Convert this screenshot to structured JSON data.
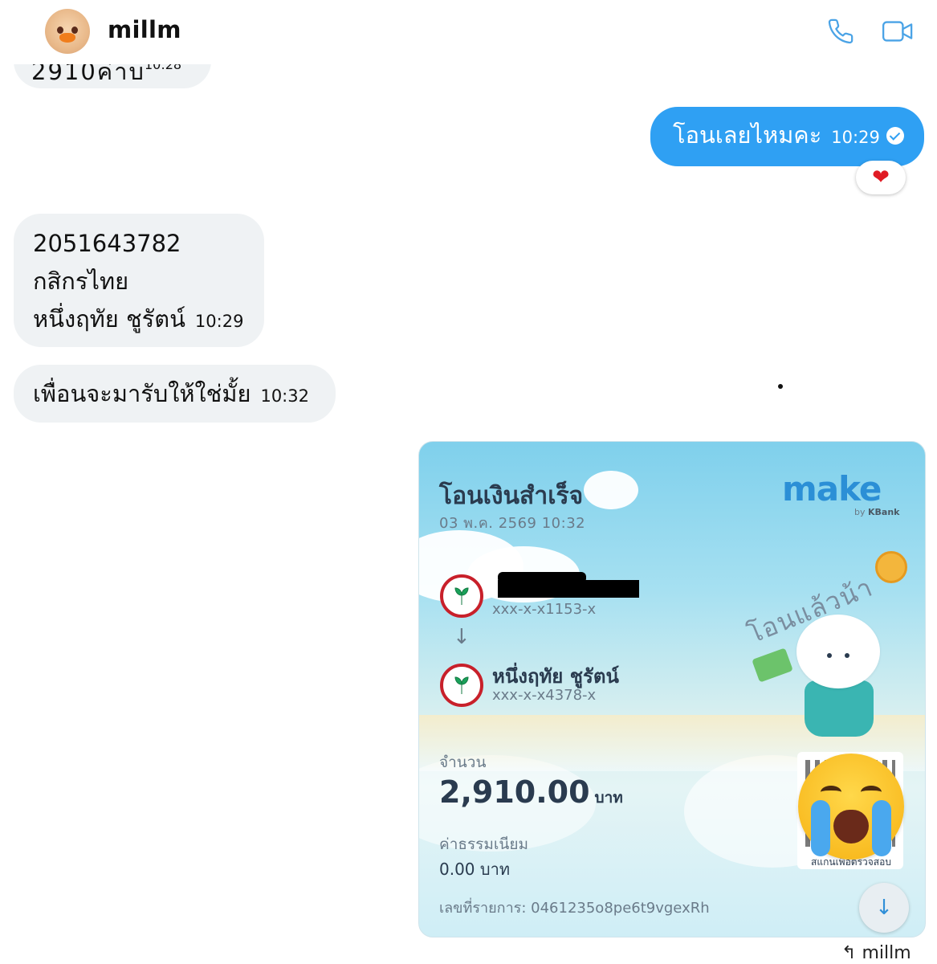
{
  "header": {
    "contact_name": "millm",
    "icons": [
      "avatar",
      "phone-icon",
      "video-call-icon"
    ]
  },
  "messages": {
    "cut_off": {
      "partial_text": "2910ค่าบ",
      "time": "10:28"
    },
    "out1": {
      "text": "โอนเลยไหมคะ",
      "time": "10:29",
      "reaction": "❤"
    },
    "in1": {
      "lines": [
        "2051643782",
        "กสิกรไทย",
        "หนึ่งฤทัย ชูรัตน์"
      ],
      "time": "10:29"
    },
    "in2": {
      "text": "เพื่อนจะมารับให้ใช่มั้ย",
      "time": "10:32"
    }
  },
  "receipt": {
    "title": "โอนเงินสำเร็จ",
    "datetime": "03 พ.ค. 2569 10:32",
    "brand": "make",
    "brand_by": "by",
    "brand_bank": "KBank",
    "from_account": "xxx-x-x1153-x",
    "to_name": "หนึ่งฤทัย ชูรัตน์",
    "to_account": "xxx-x-x4378-x",
    "amount_label": "จำนวน",
    "amount": "2,910.00",
    "amount_unit": "บาท",
    "fee_label": "ค่าธรรมเนียม",
    "fee": "0.00 บาท",
    "ref_label": "เลขที่รายการ: 0461235o8pe6t9vgexRh",
    "sticker_text": "โอนแล้วน้า",
    "qr_caption": "สแกนเพื่อตรวจสอบ",
    "accent_color": "#c8202a"
  },
  "footer": {
    "reply_to": "millm"
  },
  "colors": {
    "out_bubble": "#2fa0f3",
    "in_bubble": "#eff2f4",
    "icon": "#2f8fd8"
  }
}
